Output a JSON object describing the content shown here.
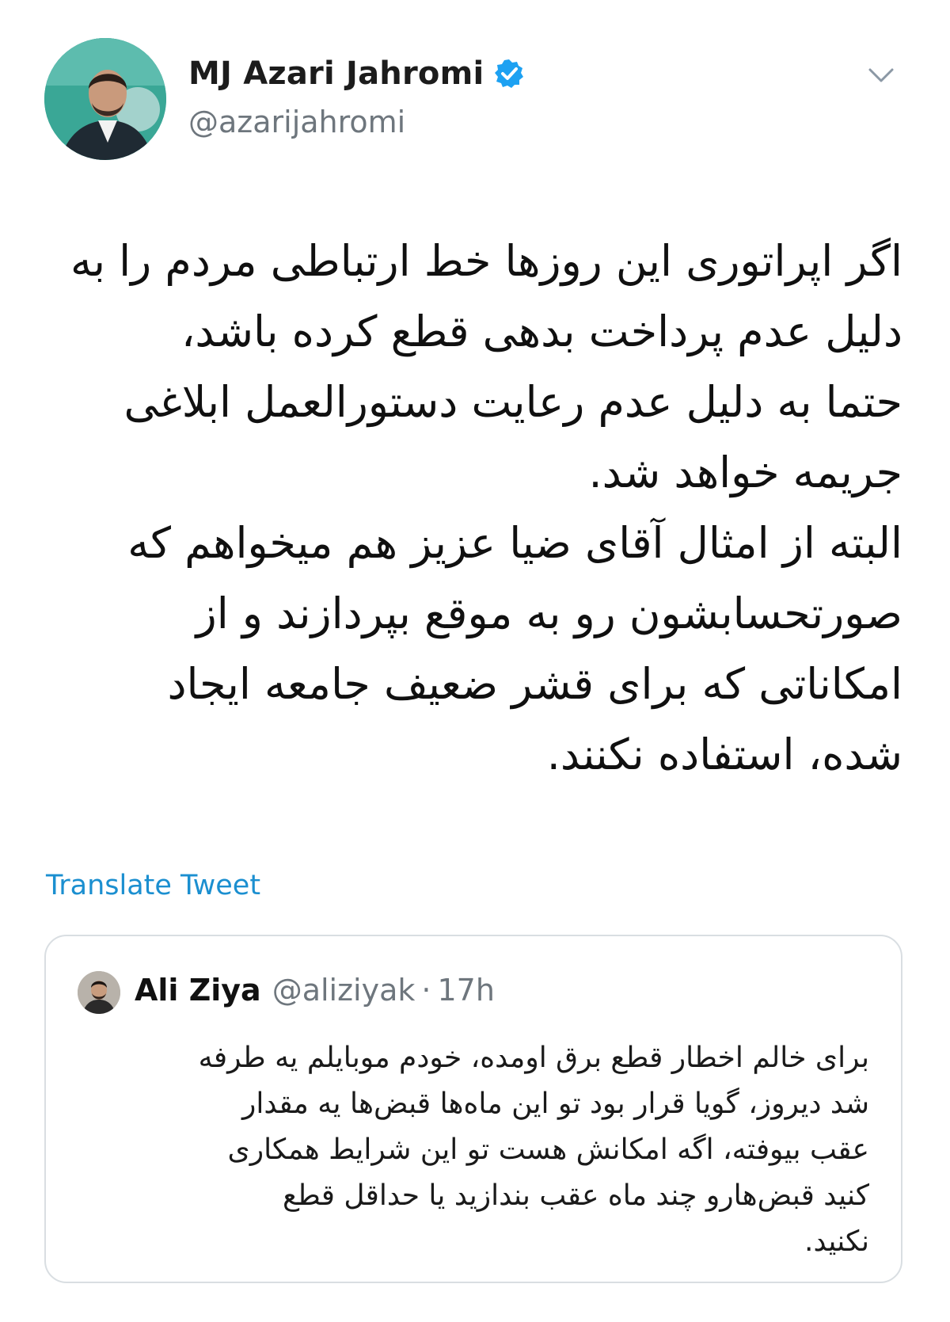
{
  "author": {
    "display_name": "MJ Azari Jahromi",
    "handle": "@azarijahromi",
    "verified": true,
    "verified_color": "#1da1f2"
  },
  "tweet": {
    "text": "اگر اپراتوری این روزها خط ارتباطی مردم را به\nدلیل عدم پرداخت بدهی قطع کرده باشد،\nحتما به دلیل عدم رعایت دستورالعمل ابلاغی\nجریمه خواهد شد.\nالبته از امثال آقای ضیا عزیز هم میخواهم که\nصورتحسابشون رو به موقع بپردازند و از\nامکاناتی که برای قشر ضعیف جامعه ایجاد\nشده، استفاده نکنند."
  },
  "actions": {
    "translate_label": "Translate Tweet"
  },
  "quoted": {
    "display_name": "Ali Ziya",
    "handle": "@aliziyak",
    "separator": "·",
    "time": "17h",
    "text": "برای خالم اخطار قطع برق اومده، خودم موبایلم یه طرفه\nشد دیروز، گویا قرار بود تو این ماه‌ها قبض‌ها یه مقدار\nعقب بیوفته، اگه امکانش هست تو این شرایط همکاری\nکنید قبض‌هارو چند ماه عقب بندازید یا حداقل قطع\nنکنید."
  },
  "colors": {
    "link": "#1b8fd0",
    "secondary_text": "#6e767d",
    "border": "#d9dee2"
  },
  "icons": [
    "verified-badge-icon",
    "chevron-down-icon"
  ]
}
